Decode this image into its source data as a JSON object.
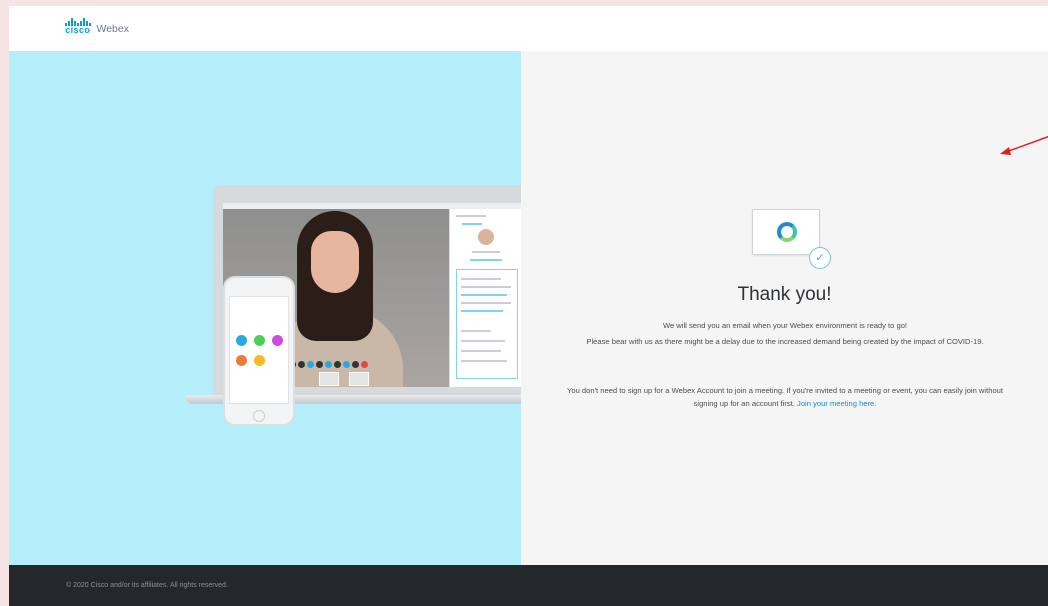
{
  "header": {
    "brand_cisco": "cisco",
    "brand_product": "Webex"
  },
  "main": {
    "heading": "Thank you!",
    "message_line1": "We will send you an email when your Webex environment is ready to go!",
    "message_line2": "Please bear with us as there might be a delay due to the increased demand being created by the impact of COVID-19.",
    "account_note": "You don't need to sign up for a Webex Account to join a meeting. If you're invited to a meeting or event, you can easily join without signing up for an account first.",
    "join_link": "Join your meeting here."
  },
  "footer": {
    "copyright": "© 2020 Cisco and/or its affiliates. All rights reserved."
  },
  "colors": {
    "brand_blue": "#049fd9",
    "left_panel_bg": "#b5eefb",
    "footer_bg": "#25282b",
    "link_blue": "#1f88c6",
    "annotation_arrow": "#e02020"
  },
  "icons": [
    "cisco-logo-icon",
    "webex-app-icon",
    "checkmark-icon",
    "red-arrow-icon"
  ]
}
